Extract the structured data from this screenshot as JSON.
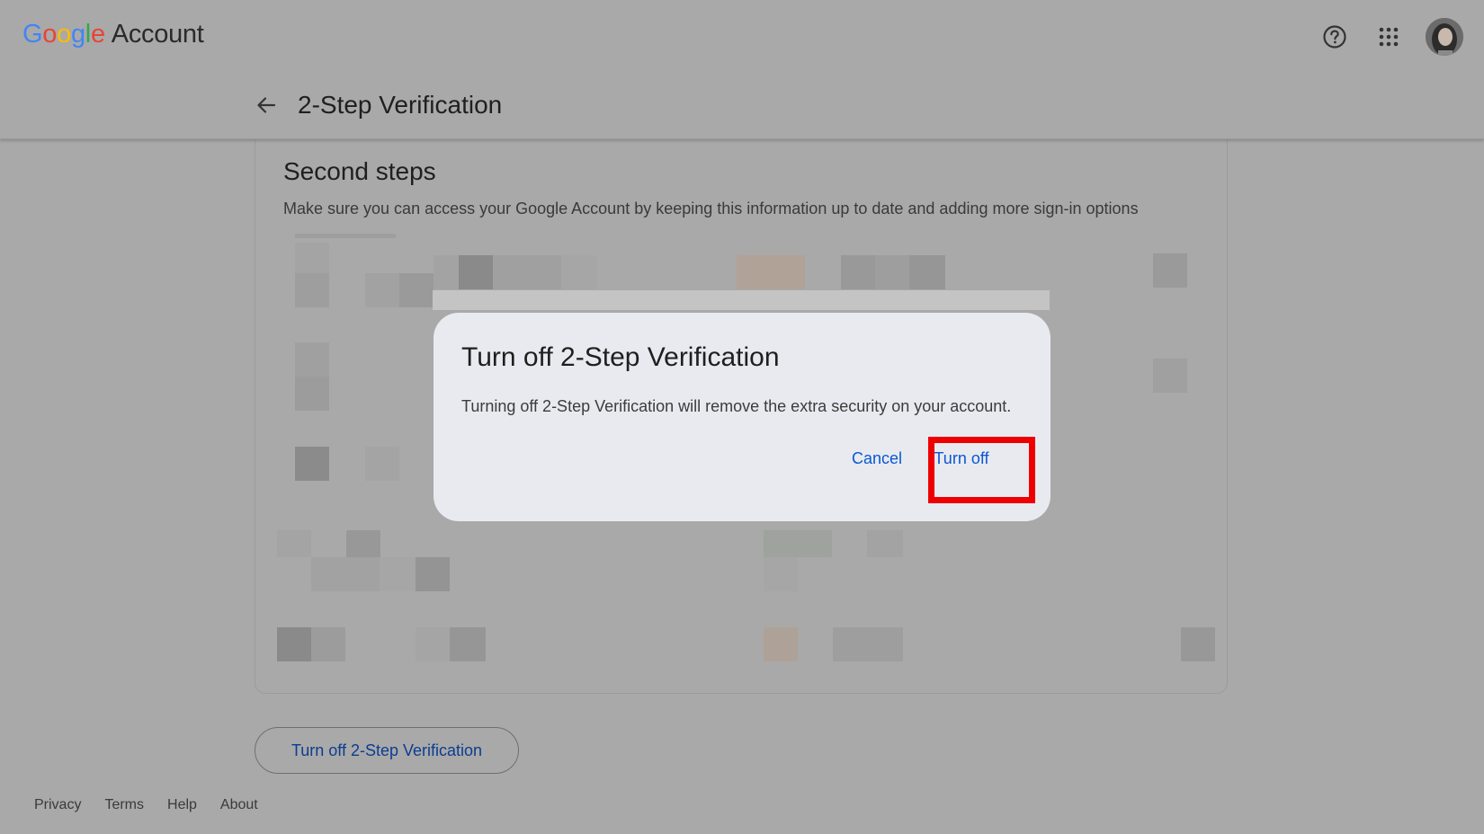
{
  "app": {
    "logo_google": [
      "G",
      "o",
      "o",
      "g",
      "l",
      "e"
    ],
    "logo_colors": [
      "#4285F4",
      "#EA4335",
      "#FBBC05",
      "#4285F4",
      "#34A853",
      "#EA4335"
    ],
    "logo_account": "Account"
  },
  "header": {
    "help_icon": "help-circle-icon",
    "apps_icon": "apps-grid-icon",
    "avatar": "user-avatar"
  },
  "subheader": {
    "back_icon": "arrow-back-icon",
    "title": "2-Step Verification"
  },
  "card": {
    "title": "Second steps",
    "description": "Make sure you can access your Google Account by keeping this information up to date and adding more sign-in options"
  },
  "dialog": {
    "title": "Turn off 2-Step Verification",
    "body": "Turning off 2-Step Verification will remove the extra security on your account.",
    "cancel_label": "Cancel",
    "confirm_label": "Turn off",
    "highlight_color": "#EE0000"
  },
  "main": {
    "turn_off_button_label": "Turn off 2-Step Verification"
  },
  "footer": {
    "links": [
      "Privacy",
      "Terms",
      "Help",
      "About"
    ]
  },
  "colors": {
    "overlay_background": "#A9A9A9",
    "dialog_background": "#E8EAF0",
    "link_blue": "#0B57D0"
  }
}
